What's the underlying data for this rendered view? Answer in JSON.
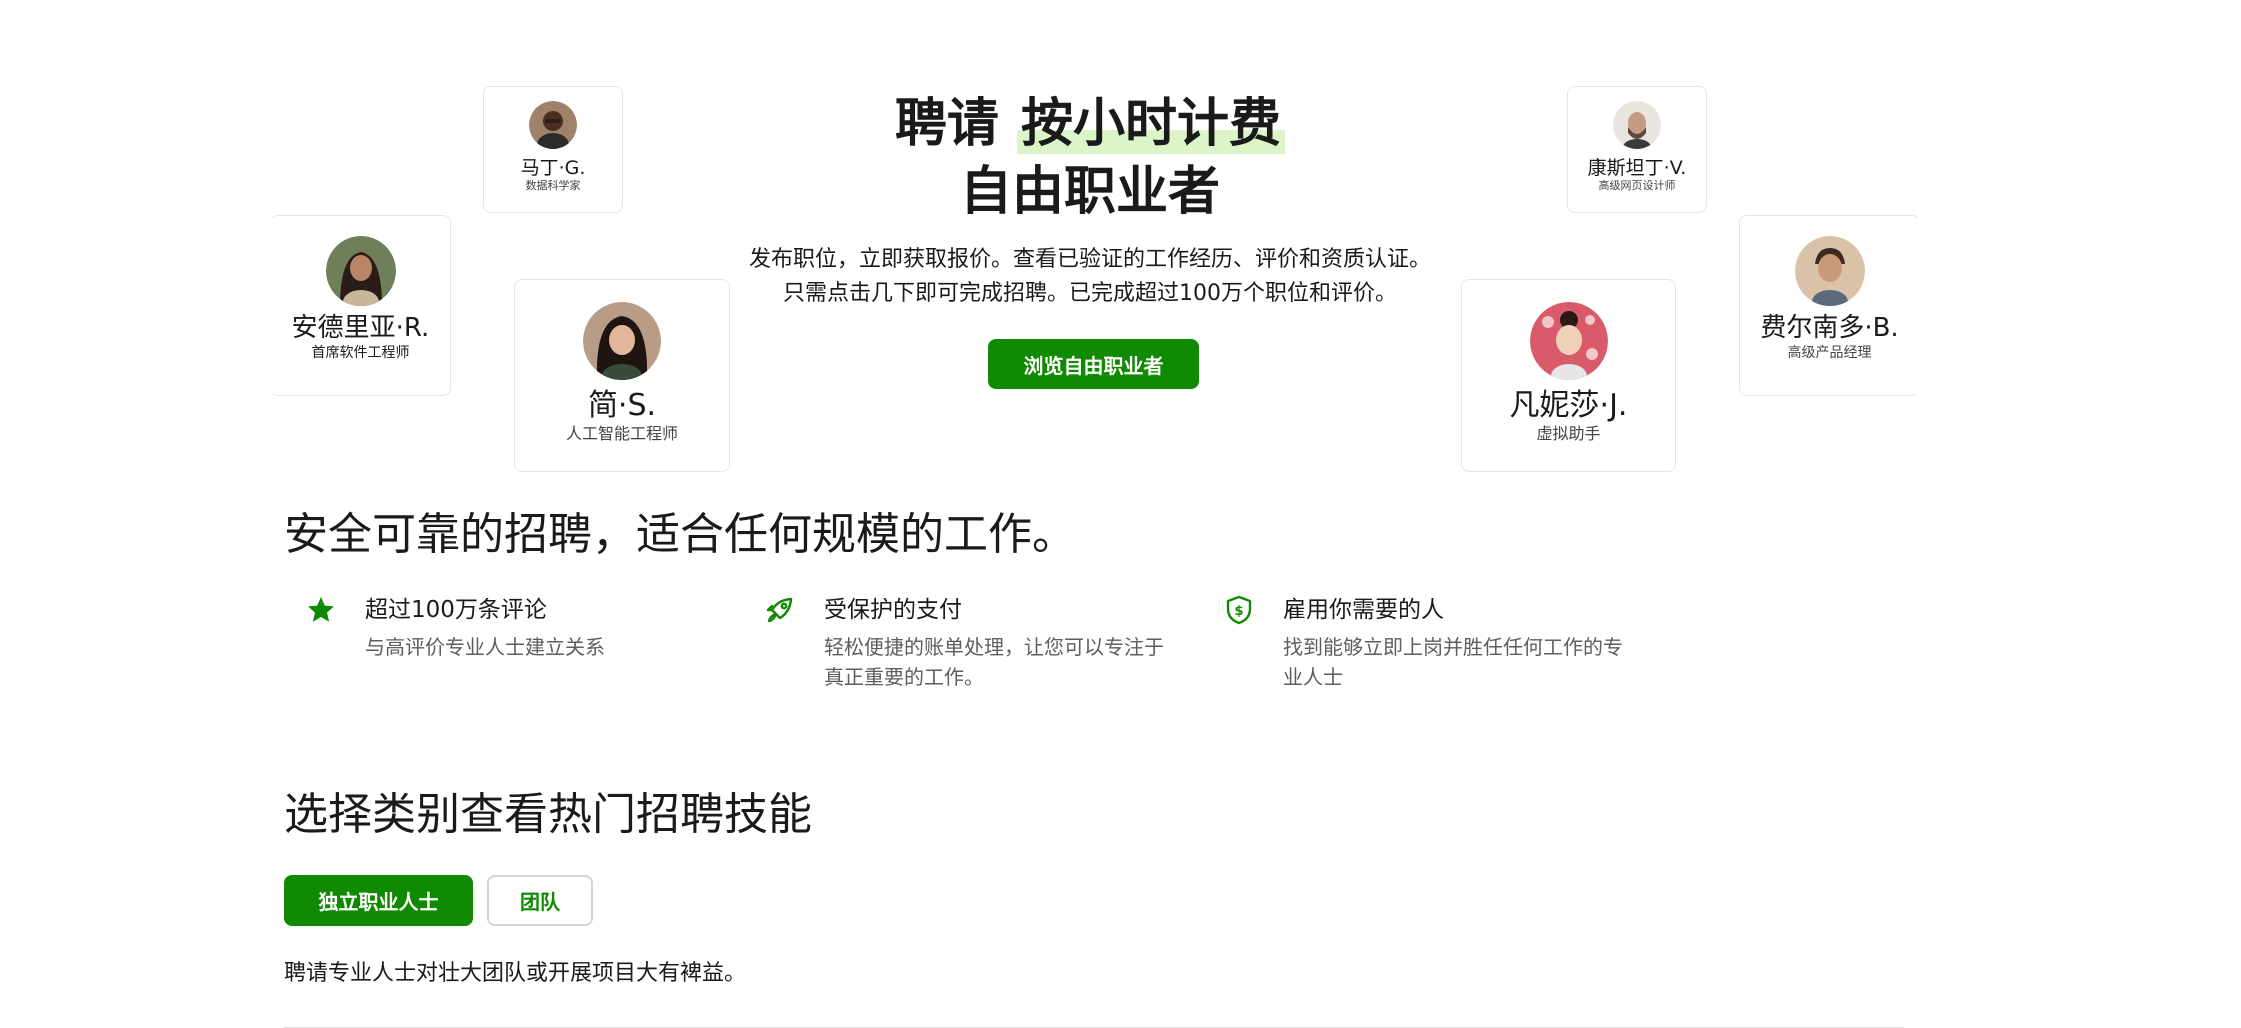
{
  "hero": {
    "title_part1": "聘请",
    "title_highlight": "按小时计费",
    "title_line2": "自由职业者",
    "description": "发布职位，立即获取报价。查看已验证的工作经历、评价和资质认证。只需点击几下即可完成招聘。已完成超过100万个职位和评价。",
    "browse_button": "浏览自由职业者"
  },
  "freelancers": [
    {
      "name": "马丁·G.",
      "role": "数据科学家"
    },
    {
      "name": "安德里亚·R.",
      "role": "首席软件工程师"
    },
    {
      "name": "简·S.",
      "role": "人工智能工程师"
    },
    {
      "name": "康斯坦丁·V.",
      "role": "高级网页设计师"
    },
    {
      "name": "凡妮莎·J.",
      "role": "虚拟助手"
    },
    {
      "name": "费尔南多·B.",
      "role": "高级产品经理"
    }
  ],
  "trust": {
    "title": "安全可靠的招聘，适合任何规模的工作。",
    "features": [
      {
        "icon": "star-icon",
        "title": "超过100万条评论",
        "description": "与高评价专业人士建立关系"
      },
      {
        "icon": "rocket-icon",
        "title": "受保护的支付",
        "description": "轻松便捷的账单处理，让您可以专注于真正重要的工作。"
      },
      {
        "icon": "shield-dollar-icon",
        "title": "雇用你需要的人",
        "description": "找到能够立即上岗并胜任任何工作的专业人士"
      }
    ]
  },
  "categories": {
    "title": "选择类别查看热门招聘技能",
    "tabs": [
      {
        "label": "独立职业人士",
        "active": true
      },
      {
        "label": "团队",
        "active": false
      }
    ],
    "description": "聘请专业人士对壮大团队或开展项目大有裨益。"
  },
  "colors": {
    "accent": "#108a00",
    "highlight": "#dcf5c8"
  }
}
